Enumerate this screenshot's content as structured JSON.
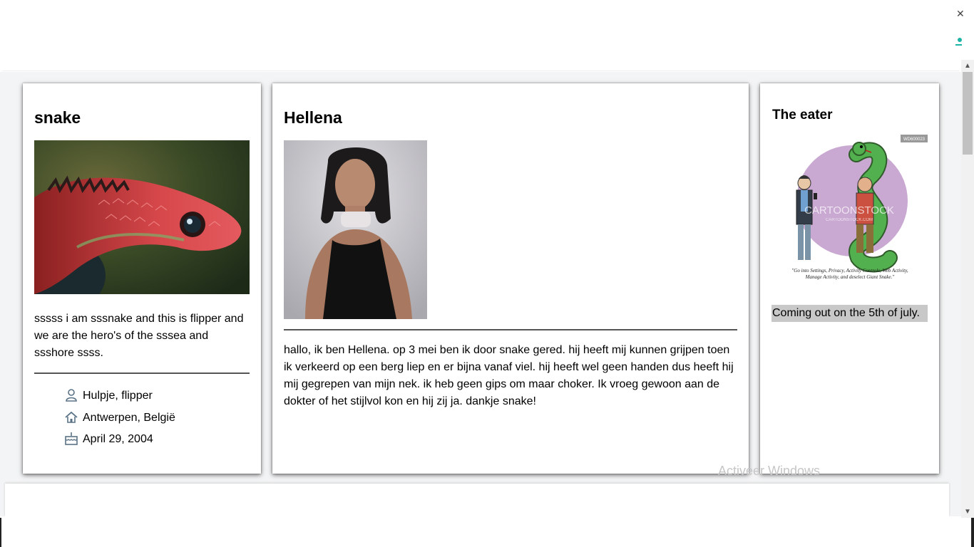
{
  "snake_card": {
    "title": "snake",
    "bio": "sssss i am sssnake and this is flipper and we are the hero's of the sssea and ssshore ssss.",
    "info": [
      {
        "icon": "person-icon",
        "text": "Hulpje, flipper"
      },
      {
        "icon": "home-icon",
        "text": "Antwerpen, België"
      },
      {
        "icon": "birthday-cake-icon",
        "text": "April 29, 2004"
      }
    ]
  },
  "hellena_card": {
    "title": "Hellena",
    "text": "hallo, ik ben Hellena. op 3 mei ben ik door snake gered. hij heeft mij kunnen grijpen toen ik verkeerd op een berg liep en er bijna vanaf viel. hij heeft wel geen handen dus heeft hij mij gegrepen van mijn nek. ik heb geen gips om maar choker. Ik vroeg gewoon aan de dokter of het stijlvol kon en hij zij ja. dankje snake!"
  },
  "eater_card": {
    "title": "The eater",
    "cartoon_watermark": "CARTOONSTOCK",
    "cartoon_watermark_sub": "CARTOONSTOCK.COM",
    "cartoon_id": "WD600023",
    "cartoon_caption_line1": "\"Go into Settings, Privacy, Activity Controls, Web Activity,",
    "cartoon_caption_line2": "Manage Activity, and deselect Giant Snake.\"",
    "coming_soon": "Coming out on the 5th of july."
  },
  "os_watermark": "Activeer Windows",
  "colors": {
    "page_bg": "#f3f4f5",
    "card_bg": "#ffffff",
    "icon_color": "#5a7286",
    "coming_highlight": "#c8c8c8"
  }
}
